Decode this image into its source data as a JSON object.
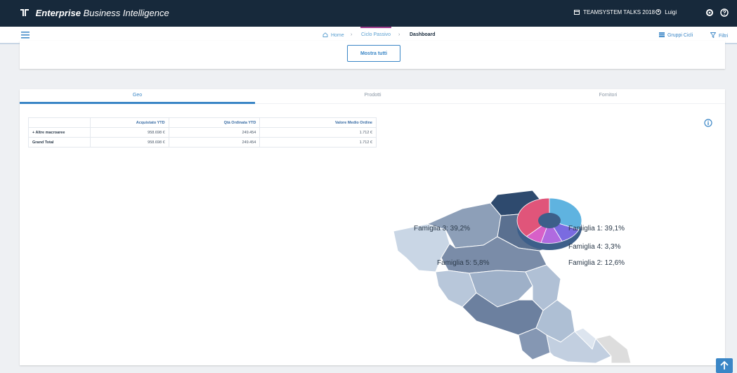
{
  "app": {
    "brand_bold": "Enterprise",
    "brand_light": "Business Intelligence",
    "workspace": "TEAMSYSTEM TALKS 2018",
    "user": "Luigi"
  },
  "breadcrumb": {
    "home": "Home",
    "section": "Ciclo Passivo",
    "current": "Dashboard"
  },
  "nav_actions": {
    "groups": "Gruppi Cicli",
    "filters": "Filtri"
  },
  "top_panel": {
    "show_all": "Mostra tutti"
  },
  "tabs": [
    "Geo",
    "Prodotti",
    "Fornitori"
  ],
  "table": {
    "headers": [
      "",
      "Acquistato YTD",
      "Qtà Ordinata YTD",
      "Valore Medio Ordine"
    ],
    "rows": [
      [
        "+ Altre macroaree",
        "958.698 €",
        "249.454",
        "1.712 €"
      ],
      [
        "Grand Total",
        "958.698 €",
        "249.454",
        "1.712 €"
      ]
    ]
  },
  "pie": {
    "labels": [
      "Famiglia 3: 39,2%",
      "Famiglia 1: 39,1%",
      "Famiglia 4: 3,3%",
      "Famiglia 5: 5,8%",
      "Famiglia 2: 12,6%"
    ]
  },
  "colors": {
    "topbar": "#17293b",
    "accent": "#3a86c6",
    "famiglia_1": "#5fb3e0",
    "famiglia_2": "#7a6be0",
    "famiglia_3": "#e0557a",
    "famiglia_4": "#b06ae0",
    "famiglia_5": "#d860c8"
  },
  "icons": [
    "app-logo-icon",
    "calendar-icon",
    "user-icon",
    "settings-icon",
    "help-icon",
    "menu-icon",
    "home-icon",
    "groups-icon",
    "filter-icon",
    "info-icon",
    "arrow-up-icon"
  ]
}
